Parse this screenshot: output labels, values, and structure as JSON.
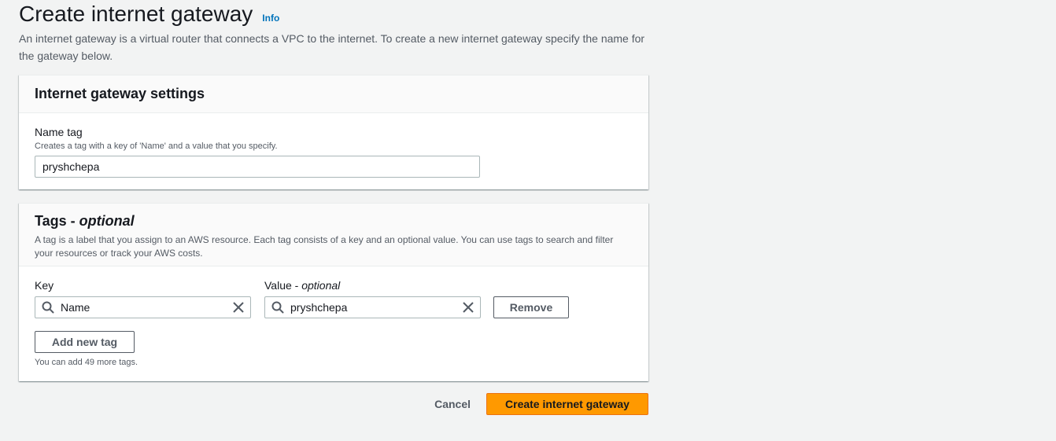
{
  "header": {
    "title": "Create internet gateway",
    "info_label": "Info",
    "description": "An internet gateway is a virtual router that connects a VPC to the internet. To create a new internet gateway specify the name for the gateway below."
  },
  "settings_panel": {
    "title": "Internet gateway settings",
    "name_tag_label": "Name tag",
    "name_tag_hint": "Creates a tag with a key of 'Name' and a value that you specify.",
    "name_tag_value": "pryshchepa"
  },
  "tags_panel": {
    "title": "Tags - ",
    "title_suffix": "optional",
    "description": "A tag is a label that you assign to an AWS resource. Each tag consists of a key and an optional value. You can use tags to search and filter your resources or track your AWS costs.",
    "key_label": "Key",
    "value_label": "Value - ",
    "value_label_suffix": "optional",
    "tags": [
      {
        "key": "Name",
        "value": "pryshchepa",
        "remove_label": "Remove"
      }
    ],
    "add_tag_label": "Add new tag",
    "limit_text": "You can add 49 more tags."
  },
  "footer": {
    "cancel_label": "Cancel",
    "create_label": "Create internet gateway"
  },
  "colors": {
    "background": "#f2f3f3",
    "primary_button": "#ff9900",
    "link": "#0073bb"
  },
  "icons": {
    "search": "search-icon",
    "clear": "close-icon"
  }
}
